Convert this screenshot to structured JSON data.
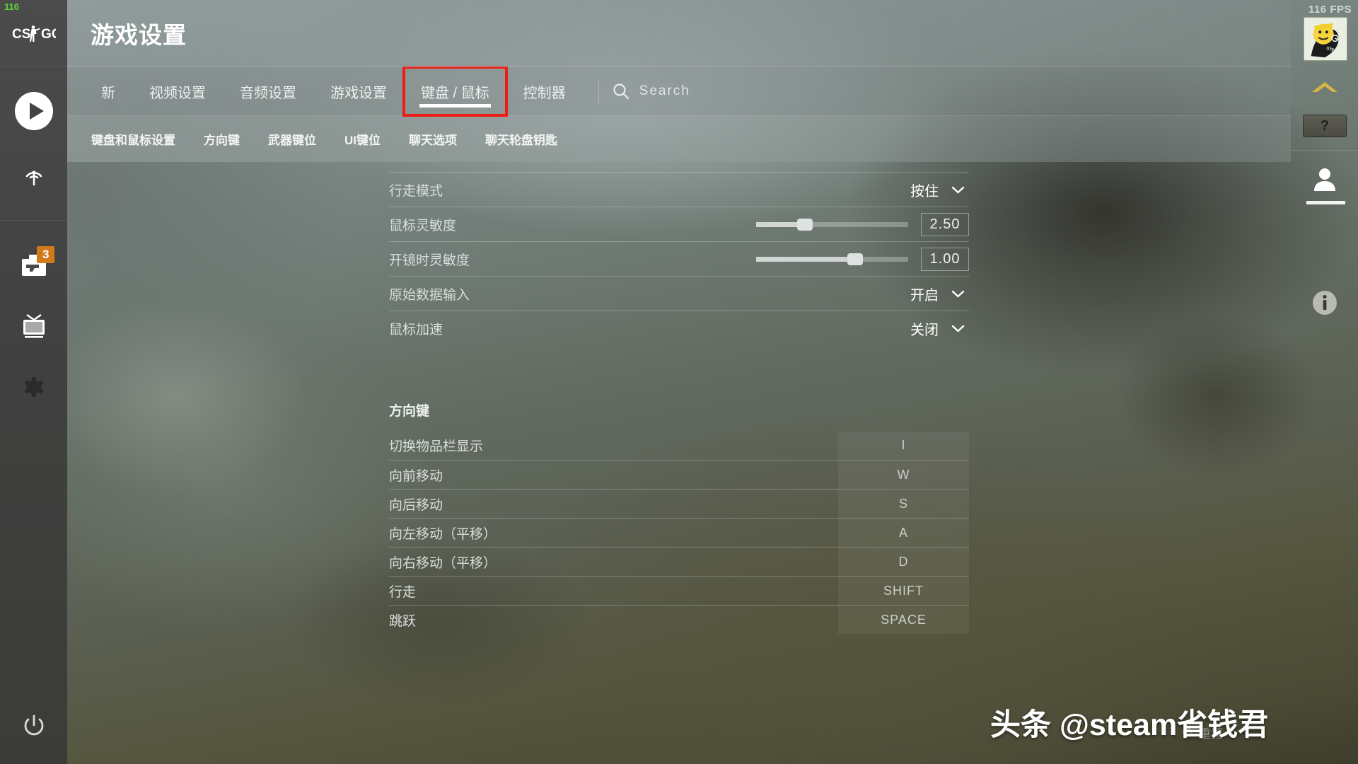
{
  "hud": {
    "fps_counter_topleft": "116",
    "fps_counter_right": "116 FPS"
  },
  "left_rail": {
    "logo": "CS:GO",
    "items": [
      {
        "name": "play",
        "icon": "play-icon",
        "badge": ""
      },
      {
        "name": "watch-broadcast",
        "icon": "broadcast-icon",
        "badge": ""
      },
      {
        "name": "inventory",
        "icon": "weapon-case-icon",
        "badge": "3"
      },
      {
        "name": "watch-tv",
        "icon": "tv-icon",
        "badge": ""
      },
      {
        "name": "settings",
        "icon": "gear-icon",
        "badge": ""
      }
    ],
    "power": "power-icon"
  },
  "header": {
    "title": "游戏设置"
  },
  "tabs": [
    {
      "label": "新",
      "active": false,
      "highlight": false
    },
    {
      "label": "视频设置",
      "active": false,
      "highlight": false
    },
    {
      "label": "音频设置",
      "active": false,
      "highlight": false
    },
    {
      "label": "游戏设置",
      "active": false,
      "highlight": false
    },
    {
      "label": "键盘 / 鼠标",
      "active": true,
      "highlight": true
    },
    {
      "label": "控制器",
      "active": false,
      "highlight": false
    }
  ],
  "search": {
    "icon": "search-icon",
    "placeholder": "Search",
    "value": "Search"
  },
  "subtabs": [
    {
      "label": "键盘和鼠标设置"
    },
    {
      "label": "方向键"
    },
    {
      "label": "武器键位"
    },
    {
      "label": "UI键位"
    },
    {
      "label": "聊天选项"
    },
    {
      "label": "聊天轮盘钥匙"
    }
  ],
  "settings_rows": [
    {
      "label": "行走模式",
      "control": "dropdown",
      "value": "按住"
    },
    {
      "label": "鼠标灵敏度",
      "control": "slider",
      "value": "2.50",
      "fill_pct": 30,
      "knob_pct": 32
    },
    {
      "label": "开镜时灵敏度",
      "control": "slider",
      "value": "1.00",
      "fill_pct": 65,
      "knob_pct": 65
    },
    {
      "label": "原始数据输入",
      "control": "dropdown",
      "value": "开启"
    },
    {
      "label": "鼠标加速",
      "control": "dropdown",
      "value": "关闭"
    }
  ],
  "section": {
    "title": "方向键"
  },
  "keybinds": [
    {
      "label": "切换物品栏显示",
      "key": "I"
    },
    {
      "label": "向前移动",
      "key": "W"
    },
    {
      "label": "向后移动",
      "key": "S"
    },
    {
      "label": "向左移动（平移）",
      "key": "A"
    },
    {
      "label": "向右移动（平移）",
      "key": "D"
    },
    {
      "label": "行走",
      "key": "SHIFT"
    },
    {
      "label": "跳跃",
      "key": "SPACE"
    }
  ],
  "right_rail": {
    "avatar": "steam-avatar",
    "collapse": "chevron-up-icon",
    "help": "?",
    "person": "person-icon",
    "info": "info-icon"
  },
  "footer": {
    "reset_label": "重置"
  },
  "watermark": {
    "text": "头条 @steam省钱君"
  },
  "colors": {
    "accent_red": "#ef1c15",
    "badge_orange": "#d2791a",
    "fps_green": "#5ed23a"
  }
}
